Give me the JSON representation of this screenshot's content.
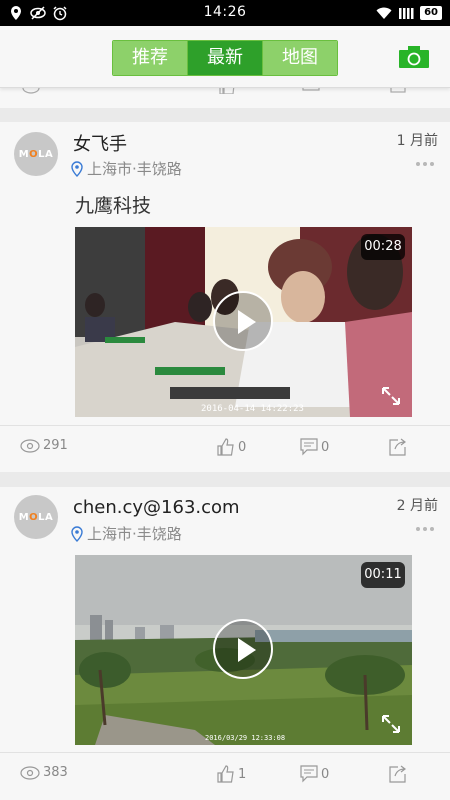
{
  "status_bar": {
    "time": "14:26",
    "battery": "60",
    "icons_left": [
      "location-icon",
      "eye-off-icon",
      "alarm-icon"
    ],
    "icons_right": [
      "wifi-icon",
      "signal-icon",
      "battery-icon"
    ]
  },
  "header": {
    "tabs": [
      {
        "label": "推荐",
        "active": false
      },
      {
        "label": "最新",
        "active": true
      },
      {
        "label": "地图",
        "active": false
      }
    ],
    "camera_icon": "camera-icon",
    "accent_color": "#2ea02a",
    "tab_color": "#8dd16a"
  },
  "posts": [
    {
      "avatar_text": "MOLA",
      "username": "女飞手",
      "location": "上海市·丰饶路",
      "time_ago": "1 月前",
      "description": "九鹰科技",
      "video": {
        "duration": "00:28",
        "stamp": "2016-04-14 14:22:23"
      },
      "views": "291",
      "likes": "0",
      "comments": "0"
    },
    {
      "avatar_text": "MOLA",
      "username": "chen.cy@163.com",
      "location": "上海市·丰饶路",
      "time_ago": "2 月前",
      "description": "",
      "video": {
        "duration": "00:11",
        "stamp": "2016/03/29 12:33:08"
      },
      "views": "383",
      "likes": "1",
      "comments": "0"
    }
  ]
}
